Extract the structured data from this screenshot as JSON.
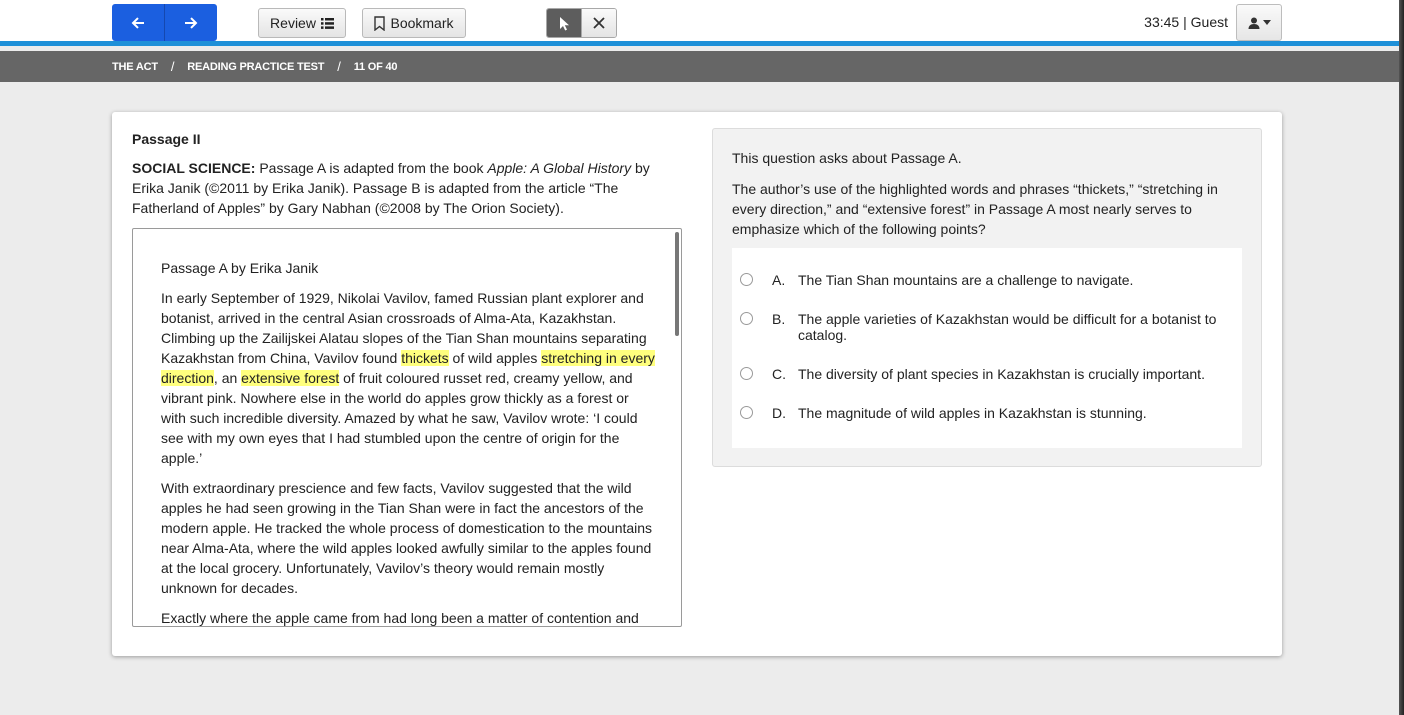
{
  "toolbar": {
    "review_label": "Review",
    "bookmark_label": "Bookmark"
  },
  "header": {
    "timer": "33:45",
    "separator": "|",
    "user": "Guest"
  },
  "breadcrumb": [
    "THE ACT",
    "READING PRACTICE TEST",
    "11 OF 40"
  ],
  "breadcrumb_sep": "/",
  "passage": {
    "title": "Passage II",
    "intro_label": "SOCIAL SCIENCE:",
    "intro_a": " Passage A is adapted from the book ",
    "intro_book": "Apple: A Global History",
    "intro_b": " by Erika Janik (©2011 by Erika Janik). Passage B is adapted from the article “The Fatherland of Apples” by Gary Nabhan (©2008 by The Orion Society).",
    "subtitle": "Passage A by Erika Janik",
    "p1_a": "In early September of 1929, Nikolai Vavilov, famed Russian plant explorer and botanist, arrived in the central Asian crossroads of Alma-Ata, Kazakhstan. Climbing up the Zailijskei Alatau slopes of the Tian Shan mountains separating Kazakhstan from China, Vavilov found ",
    "p1_hl1": "thickets",
    "p1_b": " of wild apples ",
    "p1_hl2": "stretching in every direction",
    "p1_c": ", an ",
    "p1_hl3": "extensive forest",
    "p1_d": " of fruit coloured russet red, creamy yellow, and vibrant pink. Nowhere else in the world do apples grow thickly as a forest or with such incredible diversity. Amazed by what he saw, Vavilov wrote: ‘I could see with my own eyes that I had stumbled upon the centre of origin for the apple.’",
    "p2": "With extraordinary prescience and few facts, Vavilov suggested that the wild apples he had seen growing in the Tian Shan were in fact the ancestors of the modern apple. He tracked the whole process of domestication to the mountains near Alma-Ata, where the wild apples looked awfully similar to the apples found at the local grocery. Unfortunately, Vavilov’s theory would remain mostly unknown for decades.",
    "p3": "Exactly where the apple came from had long been a matter of contention and"
  },
  "question": {
    "intro": "This question asks about Passage A.",
    "stem": "The author’s use of the highlighted words and phrases “thickets,” “stretching in every direction,” and “extensive forest” in Passage A most nearly serves to emphasize which of the following points?",
    "choices": [
      {
        "letter": "A.",
        "text": "The Tian Shan mountains are a challenge to navigate."
      },
      {
        "letter": "B.",
        "text": "The apple varieties of Kazakhstan would be difficult for a botanist to catalog."
      },
      {
        "letter": "C.",
        "text": "The diversity of plant species in Kazakhstan is crucially important."
      },
      {
        "letter": "D.",
        "text": "The magnitude of wild apples in Kazakhstan is stunning."
      }
    ]
  },
  "colors": {
    "primary_blue": "#1b5fe0",
    "accent_bar": "#1e90d8",
    "breadcrumb_bg": "#666666",
    "highlight": "#ffff7e"
  },
  "icons": {
    "back": "arrow-left-icon",
    "forward": "arrow-right-icon",
    "review": "list-icon",
    "bookmark": "bookmark-icon",
    "pointer": "cursor-pointer-icon",
    "close": "close-icon",
    "user": "user-icon",
    "caret": "caret-down-icon"
  }
}
